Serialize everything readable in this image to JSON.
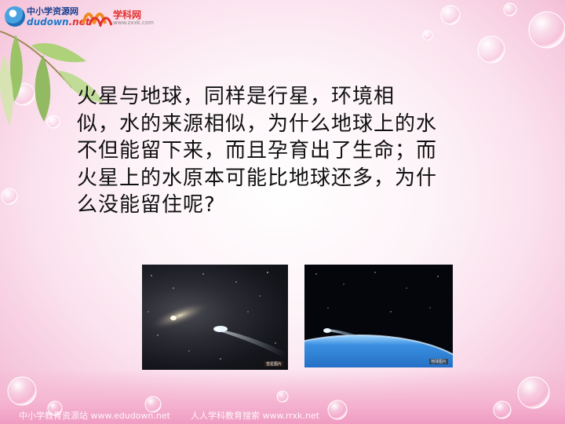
{
  "logos": {
    "site1_cn": "中小学资源网",
    "site1_en_main": "dudown",
    "site1_en_suffix": ".net",
    "site2_cn": "学科网",
    "site2_en": "www.zxxk.com"
  },
  "content": {
    "paragraph": "        火星与地球，同样是行星，环境相\n似，水的来源相似，为什么地球上的水\n不但能留下来，而且孕育出了生命；而\n火星上的水原本可能比地球还多，为什\n么没能留住呢?"
  },
  "photos": [
    {
      "icon": "comet-photo",
      "caption": "彗星图片"
    },
    {
      "icon": "earth-comet-photo",
      "caption": "地球图片"
    }
  ],
  "footer": {
    "left": "中小学教育资源站 www.edudown.net",
    "right": "人人学科教育搜索 www.rrxk.net"
  },
  "colors": {
    "background_pink": "#f6c8dd",
    "text": "#111111",
    "logo_blue": "#1f77c9",
    "logo_red": "#e2312c"
  }
}
